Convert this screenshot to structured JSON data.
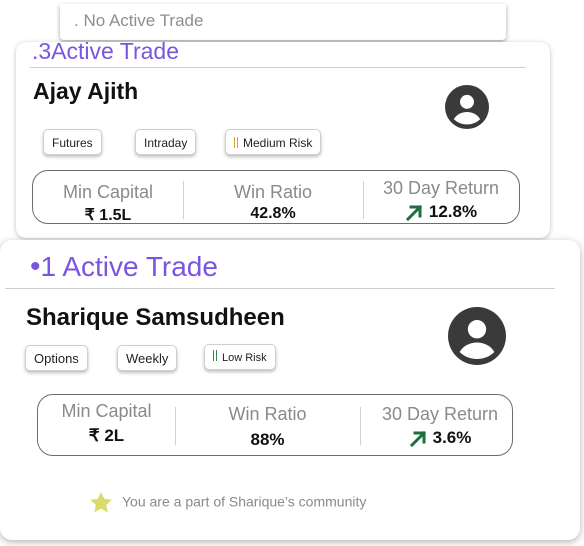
{
  "colors": {
    "accent": "#7b55e0",
    "positive": "#1e6f3a",
    "medium_risk": "#e0a030",
    "low_risk": "#2e8b4a",
    "star": "#d8dc6a"
  },
  "cards": [
    {
      "status": ". No Active Trade"
    },
    {
      "status": ".3Active Trade",
      "name": "Ajay Ajith",
      "tags": [
        "Futures",
        "Intraday",
        "Medium Risk"
      ],
      "stats": {
        "min_capital_label": "Min Capital",
        "min_capital_value": "₹ 1.5L",
        "win_ratio_label": "Win Ratio",
        "win_ratio_value": "42.8%",
        "return_label": "30 Day Return",
        "return_value": "12.8%"
      },
      "icons": {
        "avatar": "account-circle-icon",
        "return": "arrow-up-right-icon"
      }
    },
    {
      "status_dot": "•",
      "status": "1 Active Trade",
      "name": "Sharique Samsudheen",
      "tags": [
        "Options",
        "Weekly",
        "Low Risk"
      ],
      "stats": {
        "min_capital_label": "Min Capital",
        "min_capital_value": "₹ 2L",
        "win_ratio_label": "Win Ratio",
        "win_ratio_value": "88%",
        "return_label": "30 Day Return",
        "return_value": "3.6%"
      },
      "icons": {
        "avatar": "account-circle-icon",
        "return": "arrow-up-right-icon"
      },
      "community_text": "You are a part of Sharique’s community"
    }
  ]
}
